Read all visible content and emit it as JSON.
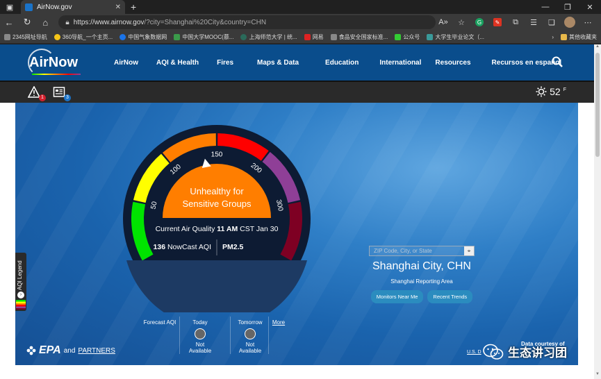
{
  "browser": {
    "tab_title": "AirNow.gov",
    "url_host": "https://www.airnow.gov",
    "url_path": "/?city=Shanghai%20City&country=CHN",
    "bookmarks": [
      "2345网址导航",
      "360导航_一个主页...",
      "中国气象数据网",
      "中国大学MOOC(慕...",
      "上海师范大学 | 统...",
      "网易",
      "食品安全国家标准...",
      "公众号",
      "大学生毕业论文（..."
    ],
    "bookmarks_right": "其他收藏夹"
  },
  "site": {
    "logo": "AirNow",
    "menu": [
      "AirNow",
      "AQI & Health",
      "Fires",
      "Maps & Data",
      "Education",
      "International",
      "Resources",
      "Recursos en español"
    ],
    "alerts_count": "1",
    "notices_count": "3",
    "temperature": "52",
    "temperature_unit": "F",
    "legend_label": "AQI Legend"
  },
  "dial": {
    "ticks": [
      "50",
      "100",
      "150",
      "200",
      "300"
    ],
    "category_line1": "Unhealthy for",
    "category_line2": "Sensitive Groups",
    "current_label": "Current Air Quality",
    "current_time": "11 AM",
    "current_date": "CST Jan 30",
    "aqi_value": "136",
    "aqi_label": "NowCast AQI",
    "pollutant": "PM2.5",
    "aqi_numeric": 136,
    "colors": {
      "good": "#00e400",
      "moderate": "#ffff00",
      "usg": "#ff7e00",
      "unhealthy": "#ff0000",
      "very_unhealthy": "#8f3f97",
      "hazardous": "#7e0023"
    }
  },
  "forecast": {
    "title": "Forecast AQI",
    "today": "Today",
    "tomorrow": "Tomorrow",
    "more": "More",
    "not": "Not",
    "available": "Available"
  },
  "location": {
    "zip_placeholder": "ZIP Code, City, or State",
    "name": "Shanghai City, CHN",
    "area": "Shanghai Reporting Area",
    "btn_monitors": "Monitors Near Me",
    "btn_trends": "Recent Trends"
  },
  "footer": {
    "epa": "EPA",
    "and": "and",
    "partners": "PARTNERS",
    "data_courtesy": "Data courtesy of",
    "usd": "U.S. D",
    "watermark": "生态讲习团"
  }
}
